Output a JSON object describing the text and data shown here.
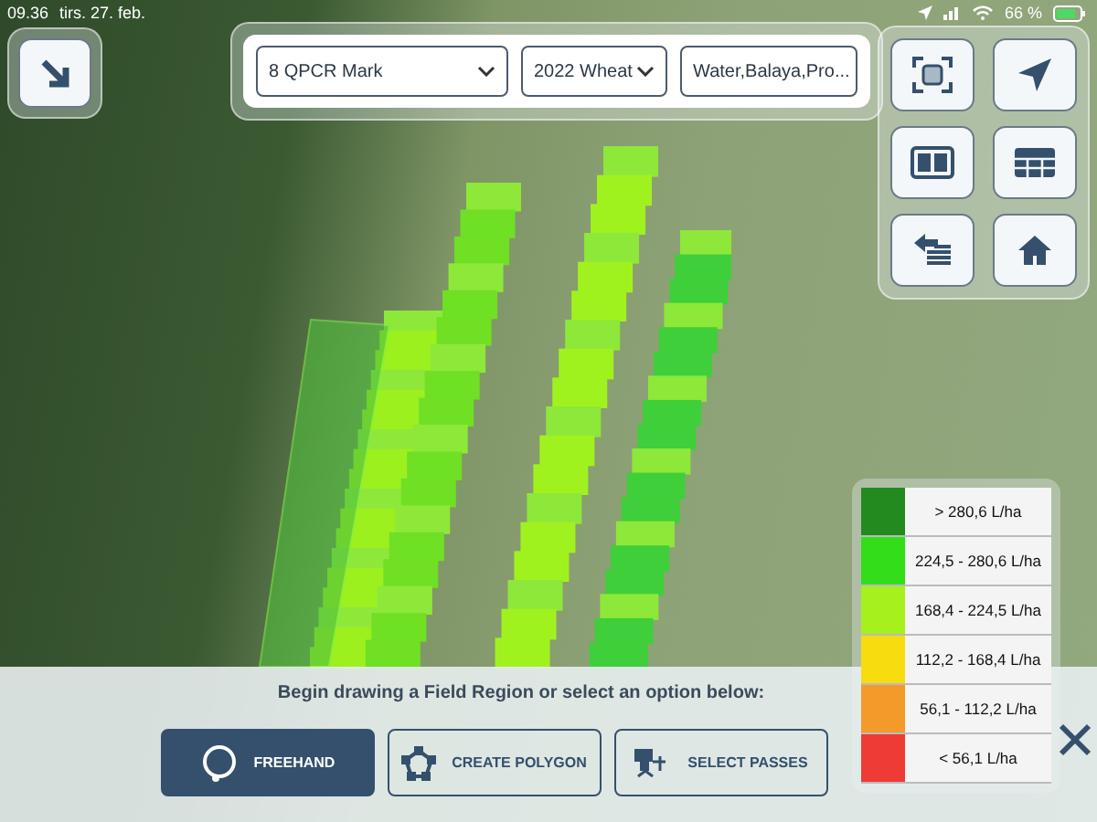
{
  "status_bar": {
    "time": "09.36",
    "date": "tirs. 27. feb.",
    "battery": "66 %"
  },
  "dropdowns": [
    {
      "value": "8 QPCR Mark"
    },
    {
      "value": "2022 Wheat"
    },
    {
      "value": "Water,Balaya,Pro..."
    }
  ],
  "legend": [
    {
      "label": "> 280,6 L/ha",
      "color": "#238a1f"
    },
    {
      "label": "224,5 - 280,6 L/ha",
      "color": "#33dd1a"
    },
    {
      "label": "168,4 - 224,5 L/ha",
      "color": "#a6f01e"
    },
    {
      "label": "112,2 - 168,4 L/ha",
      "color": "#f7dc10"
    },
    {
      "label": "56,1 - 112,2 L/ha",
      "color": "#f49a2a"
    },
    {
      "label": "< 56,1 L/ha",
      "color": "#ef3b35"
    }
  ],
  "prompt": "Begin drawing a Field Region or select an option below:",
  "actions": [
    {
      "kind": "freehand",
      "label": "FREEHAND",
      "selected": true
    },
    {
      "kind": "polygon",
      "label": "CREATE POLYGON",
      "selected": false
    },
    {
      "kind": "passes",
      "label": "SELECT PASSES",
      "selected": false
    }
  ]
}
